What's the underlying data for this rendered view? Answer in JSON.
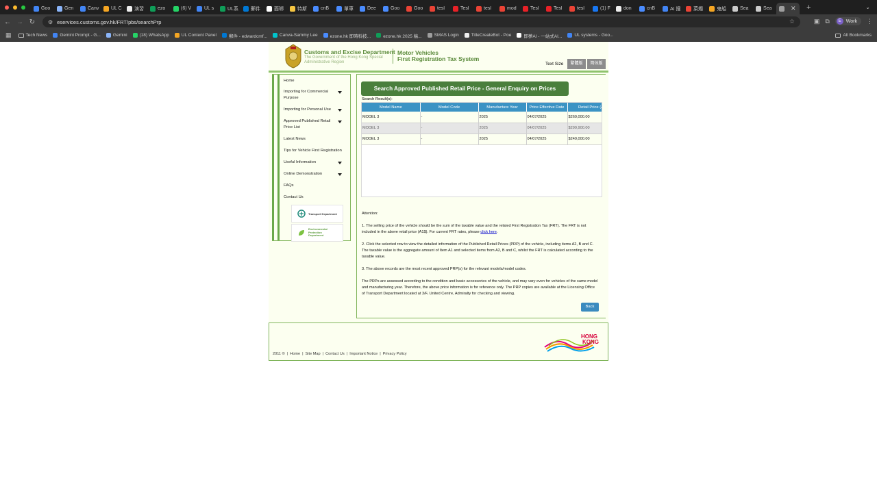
{
  "browser": {
    "colors": {
      "close": "#ff5f57",
      "min": "#febc2e",
      "max": "#28c840"
    },
    "tabs": [
      {
        "title": "Goo",
        "color": "#4285f4"
      },
      {
        "title": "Gen",
        "color": "#8ab4f8"
      },
      {
        "title": "Canv",
        "color": "#4285f4"
      },
      {
        "title": "UL C",
        "color": "#f5a623"
      },
      {
        "title": "演習",
        "color": "#eeeeee"
      },
      {
        "title": "ezo",
        "color": "#0f9d58"
      },
      {
        "title": "(6) V",
        "color": "#25d366"
      },
      {
        "title": "UL s",
        "color": "#4285f4"
      },
      {
        "title": "UL系",
        "color": "#0f9d58"
      },
      {
        "title": "郵件",
        "color": "#0078d4"
      },
      {
        "title": "面瑯",
        "color": "#ffffff"
      },
      {
        "title": "特斯",
        "color": "#f5c542"
      },
      {
        "title": "cnB",
        "color": "#4a8cff"
      },
      {
        "title": "單車",
        "color": "#4a8cff"
      },
      {
        "title": "Dee",
        "color": "#4a8cff"
      },
      {
        "title": "Goo",
        "color": "#4a8cff"
      },
      {
        "title": "Goo",
        "color": "#ea4335"
      },
      {
        "title": "tesl",
        "color": "#ea4335"
      },
      {
        "title": "Tesl",
        "color": "#e82127"
      },
      {
        "title": "tesl",
        "color": "#ea4335"
      },
      {
        "title": "mod",
        "color": "#ea4335"
      },
      {
        "title": "Tesl",
        "color": "#e82127"
      },
      {
        "title": "Tesl",
        "color": "#e82127"
      },
      {
        "title": "tesl",
        "color": "#ea4335"
      },
      {
        "title": "(1) F",
        "color": "#1877f2"
      },
      {
        "title": "don",
        "color": "#eeeeee"
      },
      {
        "title": "cnB",
        "color": "#4a8cff"
      },
      {
        "title": "AI 搜",
        "color": "#4285f4"
      },
      {
        "title": "菜燭",
        "color": "#ea4335"
      },
      {
        "title": "鬼船",
        "color": "#f5a623"
      },
      {
        "title": "Sea",
        "color": "#cccccc"
      },
      {
        "title": "Sea",
        "color": "#cccccc"
      }
    ],
    "active_tab_close": "✕",
    "url": "eservices.customs.gov.hk/FRT/pbs/searchPrp",
    "profile_initial": "E",
    "profile_label": "Work",
    "bookmarks": [
      {
        "label": "Tech News",
        "type": "folder"
      },
      {
        "label": "Gemini Prompt - G...",
        "color": "#4285f4"
      },
      {
        "label": "Gemini",
        "color": "#8ab4f8"
      },
      {
        "label": "(18) WhatsApp",
        "color": "#25d366"
      },
      {
        "label": "UL Content Panel",
        "color": "#f5a623"
      },
      {
        "label": "郵件 - edwardcmf...",
        "color": "#0078d4"
      },
      {
        "label": "Canva-Sammy Lee",
        "color": "#00c4cc"
      },
      {
        "label": "ezone.hk 即時科技...",
        "color": "#4a8cff"
      },
      {
        "label": "ezone.hk 2025 稿...",
        "color": "#0f9d58"
      },
      {
        "label": "SMAS Login",
        "color": "#9e9e9e"
      },
      {
        "label": "TitleCreateBot - Poe",
        "color": "#eeeeee"
      },
      {
        "label": "即夢AI - 一站式AI...",
        "color": "#ffffff"
      },
      {
        "label": "UL systems - Goo...",
        "color": "#4285f4"
      }
    ],
    "all_bookmarks": "All Bookmarks"
  },
  "header": {
    "dept": "Customs and Excise Department",
    "dept_sub1": "The Government of the Hong Kong Special",
    "dept_sub2": "Administrative Region",
    "system1": "Motor Vehicles",
    "system2": "First Registration Tax System",
    "text_size": "Text Size",
    "lang_tc": "繁體版",
    "lang_sc": "简体版"
  },
  "sidebar": {
    "items": [
      {
        "label": "Home",
        "expandable": false
      },
      {
        "label": "Importing for Commercial Purpose",
        "expandable": true
      },
      {
        "label": "Importing for Personal Use",
        "expandable": true
      },
      {
        "label": "Approved Published Retail Price List",
        "expandable": true
      },
      {
        "label": "Latest News",
        "expandable": false
      },
      {
        "label": "Tips for Vehicle First Registration",
        "expandable": false
      },
      {
        "label": "Useful Information",
        "expandable": true
      },
      {
        "label": "Online Demonstration",
        "expandable": true
      },
      {
        "label": "FAQs",
        "expandable": false
      },
      {
        "label": "Contact Us",
        "expandable": false
      }
    ],
    "logo_td": "Transport Department",
    "logo_epd1": "Environmental",
    "logo_epd2": "Protection",
    "logo_epd3": "Department"
  },
  "main": {
    "title": "Search Approved Published Retail Price - General Enquiry on Prices",
    "result_label": "Search Result(s):",
    "columns": [
      "Model Name",
      "Model Code",
      "Manufacture Year",
      "Price Effective Date",
      "Retail Price (A"
    ],
    "rows": [
      [
        "MODEL 3",
        "-",
        "2025",
        "04/07/2025",
        "$269,000.00"
      ],
      [
        "MODEL 3",
        "-",
        "2025",
        "04/07/2025",
        "$299,900.00"
      ],
      [
        "MODEL 3",
        "-",
        "2025",
        "04/07/2025",
        "$249,000.00"
      ]
    ],
    "attention": "Attention:",
    "note1": "1. The selling price of the vehicle should be the sum of the taxable value and the related First Registration Tax (FRT). The FRT is not included in the above retail price (A1$). For current FRT rates, please ",
    "note1_link": "click here",
    "note1_end": ".",
    "note2": "2. Click the selected row to view the detailed information of the Published Retail Prices (PRP) of the vehicle, including items A2, B and C. The taxable value is the aggregate amount of Item A1 and selected items from A2, B and C, whilst the FRT is calculated according to the taxable value.",
    "note3": "3. The above records are the most recent approved PRP(s) for the relevant models/model codes.",
    "note4": "The PRPs are assessed according to the condition and basic accessories of the vehicle, and may vary even for vehicles of the same model and manufacturing year. Therefore, the above price information is for reference only. The PRP copies are available at the Licensing Office of Transport Department located at 3/F, United Centre, Admiralty for checking and viewing.",
    "back": "Back"
  },
  "footer": {
    "copyright": "2011 ©",
    "links": [
      "Home",
      "Site Map",
      "Contact Us",
      "Important Notice",
      "Privacy Policy"
    ],
    "logo_line1": "HONG",
    "logo_line2": "KONG"
  }
}
